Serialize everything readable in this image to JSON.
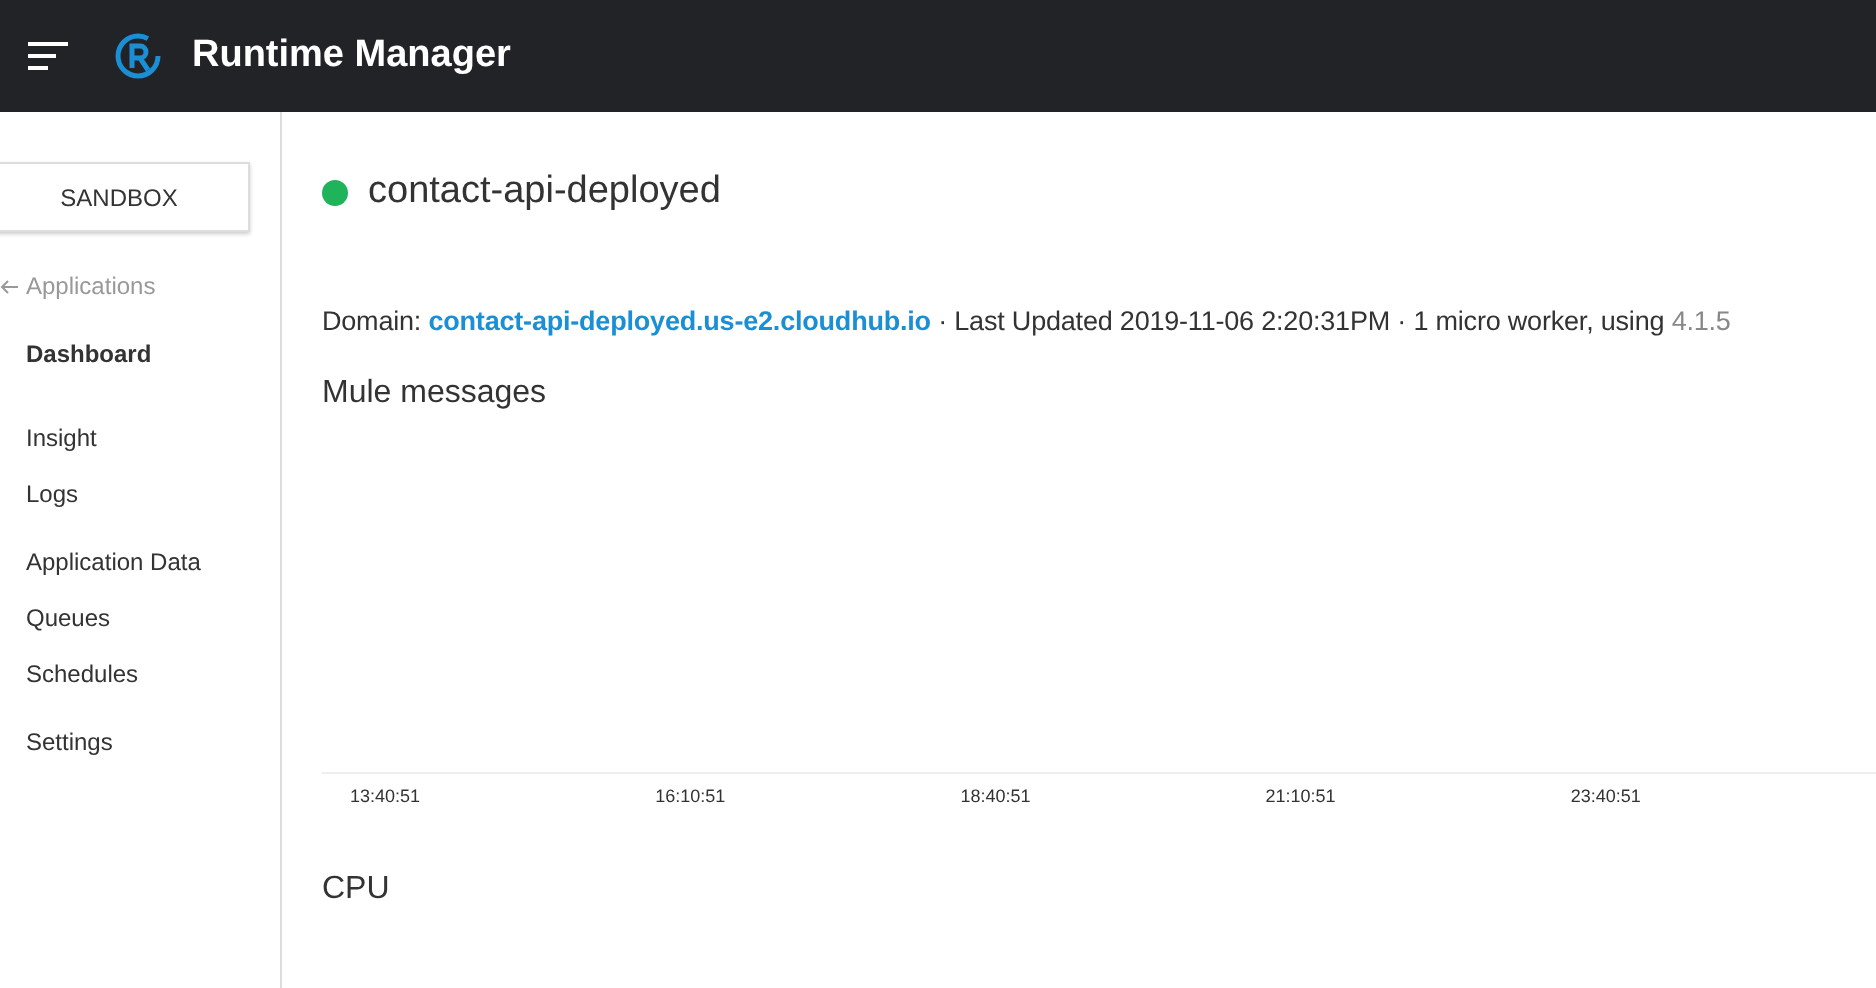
{
  "header": {
    "title": "Runtime Manager"
  },
  "sidebar": {
    "environment": "SANDBOX",
    "back_link": "Applications",
    "groups": [
      [
        {
          "label": "Dashboard",
          "selected": true
        }
      ],
      [
        {
          "label": "Insight",
          "selected": false
        },
        {
          "label": "Logs",
          "selected": false
        }
      ],
      [
        {
          "label": "Application Data",
          "selected": false
        },
        {
          "label": "Queues",
          "selected": false
        },
        {
          "label": "Schedules",
          "selected": false
        }
      ],
      [
        {
          "label": "Settings",
          "selected": false
        }
      ]
    ]
  },
  "app": {
    "name": "contact-api-deployed",
    "color": "#1fb45a",
    "domain_label": "Domain: ",
    "domain": "contact-api-deployed.us-e2.cloudhub.io",
    "details": " · Last Updated 2019-11-06 2:20:31PM · 1 micro worker, using ",
    "version": "4.1.5"
  },
  "charts": [
    {
      "title": "Mule messages",
      "time_labels": [
        "13:40:51",
        "16:10:51",
        "18:40:51",
        "21:10:51",
        "23:40:51"
      ]
    },
    {
      "title": "CPU"
    }
  ]
}
